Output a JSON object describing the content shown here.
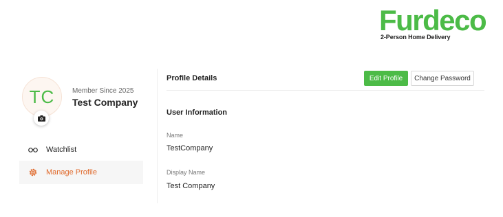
{
  "brand": {
    "name": "Furdeco",
    "tagline": "2-Person Home Delivery",
    "accent_color": "#4cbb47"
  },
  "profile": {
    "initials": "TC",
    "member_since": "Member Since 2025",
    "company_name": "Test Company",
    "camera_icon": "camera-icon"
  },
  "nav": {
    "watchlist": {
      "label": "Watchlist",
      "icon": "glasses-icon"
    },
    "manage_profile": {
      "label": "Manage Profile",
      "icon": "gear-icon",
      "active": true,
      "active_color": "#e06a2c"
    }
  },
  "details": {
    "title": "Profile Details",
    "edit_label": "Edit Profile",
    "change_password_label": "Change Password",
    "section_title": "User Information",
    "fields": [
      {
        "label": "Name",
        "value": "TestCompany"
      },
      {
        "label": "Display Name",
        "value": "Test Company"
      }
    ]
  }
}
